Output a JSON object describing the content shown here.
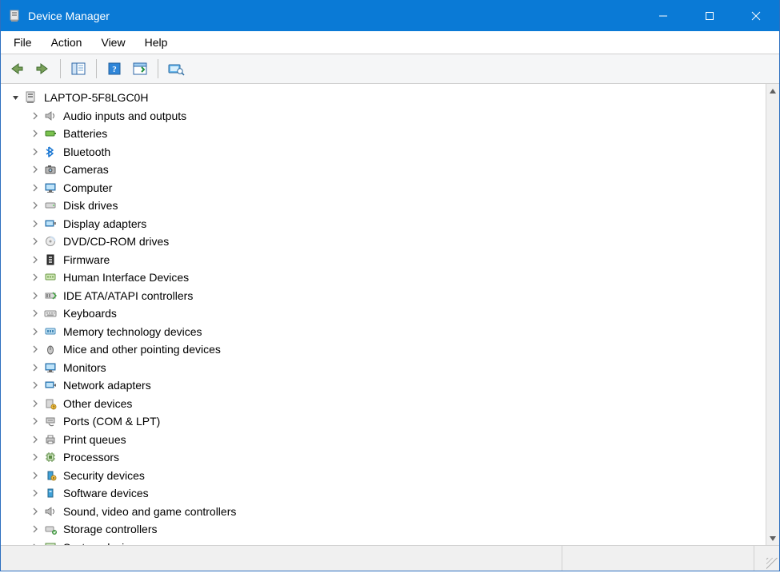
{
  "window": {
    "title": "Device Manager"
  },
  "menu": {
    "file": "File",
    "action": "Action",
    "view": "View",
    "help": "Help"
  },
  "tree": {
    "root": "LAPTOP-5F8LGC0H",
    "items": [
      {
        "label": "Audio inputs and outputs",
        "icon": "speaker"
      },
      {
        "label": "Batteries",
        "icon": "battery"
      },
      {
        "label": "Bluetooth",
        "icon": "bluetooth"
      },
      {
        "label": "Cameras",
        "icon": "camera"
      },
      {
        "label": "Computer",
        "icon": "monitor"
      },
      {
        "label": "Disk drives",
        "icon": "disk"
      },
      {
        "label": "Display adapters",
        "icon": "display-adapter"
      },
      {
        "label": "DVD/CD-ROM drives",
        "icon": "optical"
      },
      {
        "label": "Firmware",
        "icon": "firmware"
      },
      {
        "label": "Human Interface Devices",
        "icon": "hid"
      },
      {
        "label": "IDE ATA/ATAPI controllers",
        "icon": "ide"
      },
      {
        "label": "Keyboards",
        "icon": "keyboard"
      },
      {
        "label": "Memory technology devices",
        "icon": "memory"
      },
      {
        "label": "Mice and other pointing devices",
        "icon": "mouse"
      },
      {
        "label": "Monitors",
        "icon": "monitor"
      },
      {
        "label": "Network adapters",
        "icon": "network"
      },
      {
        "label": "Other devices",
        "icon": "other"
      },
      {
        "label": "Ports (COM & LPT)",
        "icon": "port"
      },
      {
        "label": "Print queues",
        "icon": "printer"
      },
      {
        "label": "Processors",
        "icon": "cpu"
      },
      {
        "label": "Security devices",
        "icon": "security"
      },
      {
        "label": "Software devices",
        "icon": "software"
      },
      {
        "label": "Sound, video and game controllers",
        "icon": "speaker"
      },
      {
        "label": "Storage controllers",
        "icon": "storage"
      },
      {
        "label": "System devices",
        "icon": "system"
      }
    ]
  },
  "colors": {
    "accent": "#0a7ad6"
  }
}
